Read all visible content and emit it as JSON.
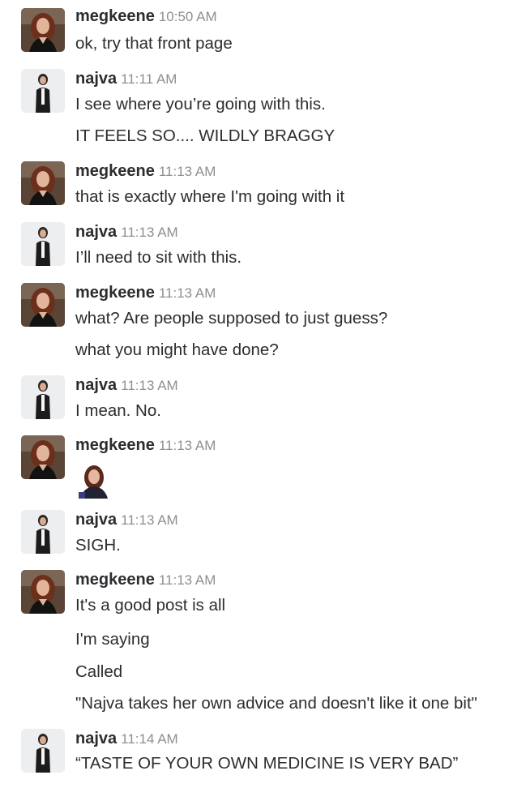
{
  "messages": [
    {
      "user": "megkeene",
      "time": "10:50 AM",
      "lines": [
        "ok, try that front page"
      ]
    },
    {
      "user": "najva",
      "time": "11:11 AM",
      "lines": [
        "I see where you’re going with this.",
        "IT FEELS SO.... WILDLY BRAGGY"
      ]
    },
    {
      "user": "megkeene",
      "time": "11:13 AM",
      "lines": [
        "that is exactly where I'm going with it"
      ]
    },
    {
      "user": "najva",
      "time": "11:13 AM",
      "lines": [
        "I’ll need to sit with this."
      ]
    },
    {
      "user": "megkeene",
      "time": "11:13 AM",
      "lines": [
        "what? Are people supposed to just guess?",
        "what you might have done?"
      ]
    },
    {
      "user": "najva",
      "time": "11:13 AM",
      "lines": [
        "I mean. No."
      ]
    },
    {
      "user": "megkeene",
      "time": "11:13 AM",
      "lines": [],
      "image": "reaction-portrait"
    },
    {
      "user": "najva",
      "time": "11:13 AM",
      "lines": [
        "SIGH."
      ]
    },
    {
      "user": "megkeene",
      "time": "11:13 AM",
      "lines": [
        "It's a good post is all",
        "I'm saying",
        "Called",
        "\"Najva takes her own advice and doesn't like it one bit\""
      ]
    },
    {
      "user": "najva",
      "time": "11:14 AM",
      "lines": [
        "“TASTE OF YOUR OWN MEDICINE IS VERY BAD”"
      ]
    }
  ]
}
